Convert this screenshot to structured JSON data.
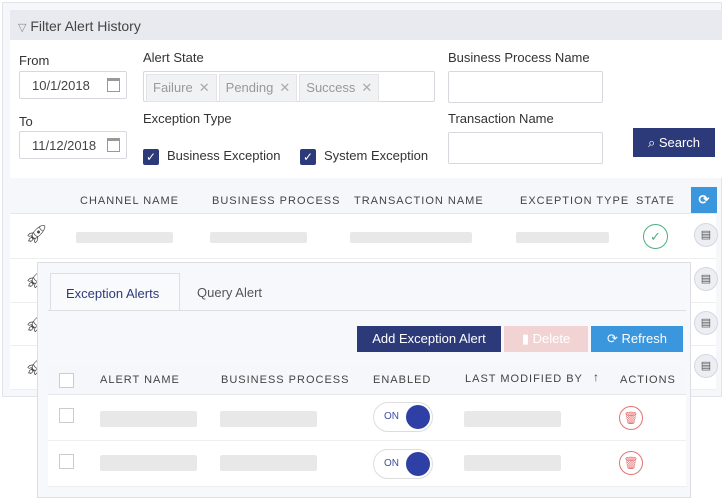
{
  "filter": {
    "title": "Filter Alert History",
    "from_label": "From",
    "from_value": "10/1/2018",
    "to_label": "To",
    "to_value": "11/12/2018",
    "alert_state_label": "Alert State",
    "alert_states": [
      "Failure",
      "Pending",
      "Success"
    ],
    "exception_type_label": "Exception Type",
    "exception_types": [
      {
        "label": "Business Exception",
        "checked": true
      },
      {
        "label": "System Exception",
        "checked": true
      }
    ],
    "bp_name_label": "Business Process Name",
    "bp_name_value": "",
    "txn_name_label": "Transaction Name",
    "txn_name_value": "",
    "search_label": "Search"
  },
  "history_table": {
    "columns": [
      "CHANNEL NAME",
      "BUSINESS PROCESS",
      "TRANSACTION NAME",
      "EXCEPTION TYPE",
      "STATE"
    ]
  },
  "panel": {
    "tabs": [
      "Exception Alerts",
      "Query Alert"
    ],
    "active_tab": "Exception Alerts",
    "add_label": "Add Exception Alert",
    "delete_label": "Delete",
    "refresh_label": "Refresh",
    "columns": [
      "ALERT NAME",
      "BUSINESS PROCESS",
      "ENABLED",
      "LAST MODIFIED BY",
      "ACTIONS"
    ],
    "sort_column": "LAST MODIFIED BY",
    "sort_direction": "ascending",
    "rows": [
      {
        "enabled": "ON"
      },
      {
        "enabled": "ON"
      }
    ]
  },
  "colors": {
    "primary": "#2d3a7a",
    "accent": "#3a96dd",
    "danger": "#e57373"
  }
}
